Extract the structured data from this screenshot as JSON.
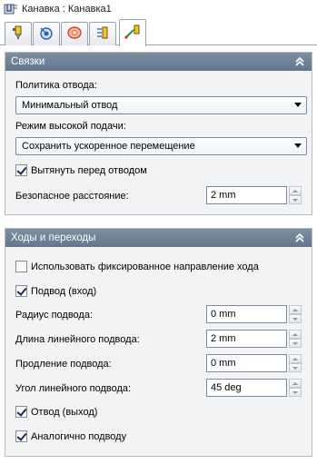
{
  "window": {
    "title": "Канавка : Канавка1",
    "icon": "groove-feature-icon"
  },
  "tabs": [
    {
      "icon": "tool-icon",
      "active": false
    },
    {
      "icon": "feed-speed-icon",
      "active": false
    },
    {
      "icon": "stock-icon",
      "active": false
    },
    {
      "icon": "depth-levels-icon",
      "active": false
    },
    {
      "icon": "links-icon",
      "active": true
    }
  ],
  "links_panel": {
    "title": "Связки",
    "retract_policy_label": "Политика отвода:",
    "retract_policy_value": "Минимальный отвод",
    "high_feed_label": "Режим высокой подачи:",
    "high_feed_value": "Сохранить ускоренное перемещение",
    "extend_before_retract_label": "Вытянуть перед отводом",
    "extend_before_retract_checked": true,
    "safe_distance_label": "Безопасное расстояние:",
    "safe_distance_value": "2 mm"
  },
  "passes_panel": {
    "title": "Ходы и переходы",
    "fixed_direction_label": "Использовать фиксированное направление хода",
    "fixed_direction_checked": false,
    "lead_in_label": "Подвод (вход)",
    "lead_in_checked": true,
    "lead_radius_label": "Радиус подвода:",
    "lead_radius_value": "0 mm",
    "linear_lead_length_label": "Длина линейного подвода:",
    "linear_lead_length_value": "2 mm",
    "lead_extension_label": "Продление подвода:",
    "lead_extension_value": "0 mm",
    "linear_lead_angle_label": "Угол линейного подвода:",
    "linear_lead_angle_value": "45 deg",
    "lead_out_label": "Отвод (выход)",
    "lead_out_checked": true,
    "same_as_lead_in_label": "Аналогично подводу",
    "same_as_lead_in_checked": true
  },
  "colors": {
    "panel_header": "#6d7f94",
    "panel_background": "#f2f3f5",
    "accent_green": "#2e8b2e"
  }
}
